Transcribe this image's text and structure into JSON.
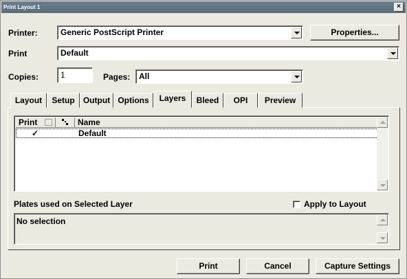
{
  "window": {
    "title": "Print Layout 1",
    "close_glyph": "×"
  },
  "printer": {
    "label": "Printer:",
    "value": "Generic PostScript Printer",
    "properties_label": "Properties..."
  },
  "print_style": {
    "label": "Print",
    "value": "Default"
  },
  "copies": {
    "label": "Copies:",
    "value": "1"
  },
  "pages": {
    "label": "Pages:",
    "value": "All"
  },
  "tabs": [
    {
      "label": "Layout"
    },
    {
      "label": "Setup"
    },
    {
      "label": "Output"
    },
    {
      "label": "Options"
    },
    {
      "label": "Layers",
      "active": true
    },
    {
      "label": "Bleed"
    },
    {
      "label": "OPI"
    },
    {
      "label": "Preview"
    }
  ],
  "layers_list": {
    "columns": {
      "print": "Print",
      "name": "Name"
    },
    "rows": [
      {
        "print": "✓",
        "name": "Default"
      }
    ]
  },
  "plates": {
    "label": "Plates used on Selected Layer",
    "apply_label": "Apply to Layout",
    "text": "No selection"
  },
  "footer": {
    "print_label": "Print",
    "cancel_label": "Cancel",
    "capture_label": "Capture Settings"
  },
  "colors": {
    "title_bar": "#5f7282",
    "face": "#ece9e1"
  }
}
